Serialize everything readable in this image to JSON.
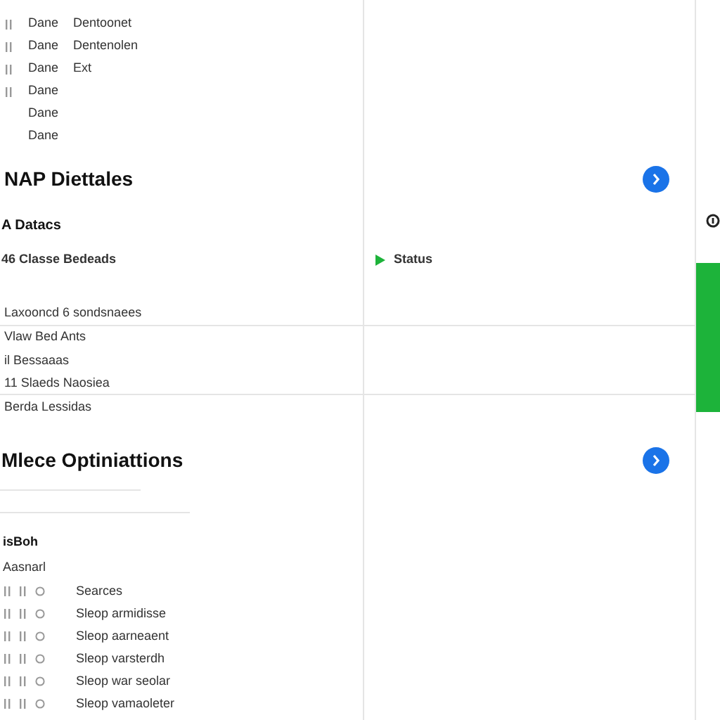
{
  "top_list": [
    {
      "has_icon": true,
      "name": "Dane",
      "detail": "Dentoonet"
    },
    {
      "has_icon": true,
      "name": "Dane",
      "detail": "Dentenolen"
    },
    {
      "has_icon": true,
      "name": "Dane",
      "detail": "Ext"
    },
    {
      "has_icon": true,
      "name": "Dane"
    },
    {
      "has_icon": false,
      "name": "Dane"
    },
    {
      "has_icon": false,
      "name": "Dane"
    }
  ],
  "nap_section": {
    "title": "NAP Diettales",
    "subtitle": "A Datacs",
    "entry": "46 Classe Bedeads",
    "status": "Status",
    "rows": [
      "Laxooncd 6 sondsnaees",
      "Vlaw Bed Ants",
      "il Bessaaas",
      "11 Slaeds Naosiea",
      "Berda Lessidas"
    ]
  },
  "optimization_section": {
    "title": "Mlece Optiniattions",
    "label": "isBoh",
    "sublabel": "Aasnarl",
    "rows": [
      "Searces",
      "Sleop armidisse",
      "Sleop aarneaent",
      "Sleop varsterdh",
      "Sleop war seolar",
      "Sleop vamaoleter"
    ]
  }
}
